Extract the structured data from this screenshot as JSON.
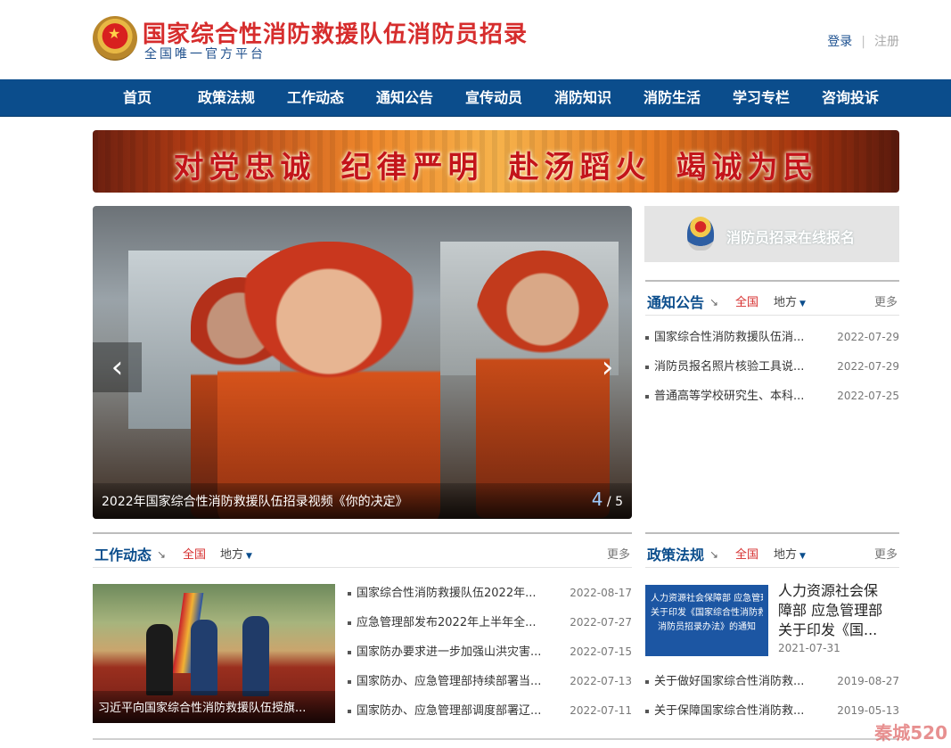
{
  "header": {
    "title": "国家综合性消防救援队伍消防员招录",
    "subtitle": "全国唯一官方平台",
    "login": "登录",
    "separator": "|",
    "register": "注册"
  },
  "nav": {
    "items": [
      "首页",
      "政策法规",
      "工作动态",
      "通知公告",
      "宣传动员",
      "消防知识",
      "消防生活",
      "学习专栏",
      "咨询投诉"
    ]
  },
  "banner": {
    "phrases": [
      "对党忠诚",
      "纪律严明",
      "赴汤蹈火",
      "竭诚为民"
    ]
  },
  "slider": {
    "caption": "2022年国家综合性消防救援队伍招录视频《你的决定》",
    "current": "4",
    "separator": "/",
    "total": "5",
    "prev_glyph": "‹",
    "next_glyph": "›"
  },
  "signup": {
    "label": "消防员招录在线报名"
  },
  "notice": {
    "title": "通知公告",
    "corner": "↘",
    "tab_all": "全国",
    "tab_local": "地方",
    "more": "更多",
    "items": [
      {
        "title": "国家综合性消防救援队伍消...",
        "date": "2022-07-29"
      },
      {
        "title": "消防员报名照片核验工具说...",
        "date": "2022-07-29"
      },
      {
        "title": "普通高等学校研究生、本科...",
        "date": "2022-07-25"
      }
    ]
  },
  "work": {
    "title": "工作动态",
    "corner": "↘",
    "tab_all": "全国",
    "tab_local": "地方",
    "more": "更多",
    "photo_caption": "习近平向国家综合性消防救援队伍授旗...",
    "items": [
      {
        "title": "国家综合性消防救援队伍2022年...",
        "date": "2022-08-17"
      },
      {
        "title": "应急管理部发布2022年上半年全...",
        "date": "2022-07-27"
      },
      {
        "title": "国家防办要求进一步加强山洪灾害...",
        "date": "2022-07-15"
      },
      {
        "title": "国家防办、应急管理部持续部署当...",
        "date": "2022-07-13"
      },
      {
        "title": "国家防办、应急管理部调度部署辽...",
        "date": "2022-07-11"
      }
    ]
  },
  "policy": {
    "title": "政策法规",
    "corner": "↘",
    "tab_all": "全国",
    "tab_local": "地方",
    "more": "更多",
    "card_lines": [
      "人力资源社会保障部 应急管理部",
      "关于印发《国家综合性消防救援队伍",
      "消防员招录办法》的通知"
    ],
    "featured_title": "人力资源社会保障部 应急管理部关于印发《国...",
    "featured_date": "2021-07-31",
    "items": [
      {
        "title": "关于做好国家综合性消防救...",
        "date": "2019-08-27"
      },
      {
        "title": "关于保障国家综合性消防救...",
        "date": "2019-05-13"
      }
    ]
  },
  "watermark": "秦城520"
}
